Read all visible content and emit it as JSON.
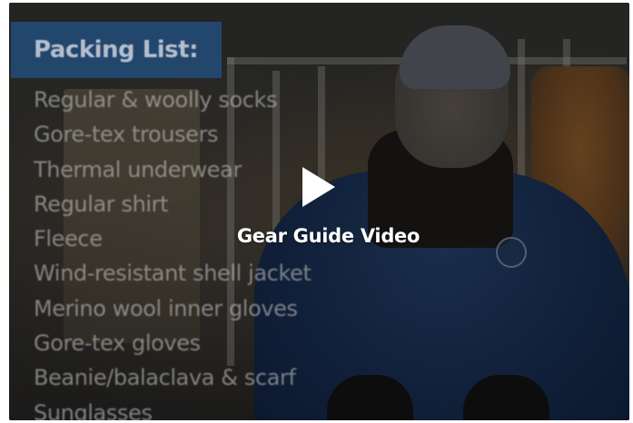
{
  "video": {
    "caption": "Gear Guide Video"
  },
  "packing_list": {
    "title": "Packing List:",
    "items": [
      "Regular & woolly socks",
      "Gore-tex trousers",
      "Thermal underwear",
      "Regular shirt",
      "Fleece",
      "Wind-resistant shell jacket",
      "Merino wool inner gloves",
      "Gore-tex gloves",
      "Beanie/balaclava & scarf",
      "Sunglasses"
    ]
  },
  "icons": {
    "play": "play-icon"
  },
  "colors": {
    "list_header_bg": "#244a76",
    "caption_text": "#ffffff",
    "jacket_blue": "#1c355e"
  }
}
